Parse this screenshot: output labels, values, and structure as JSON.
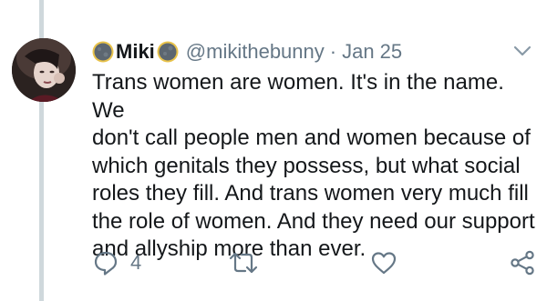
{
  "tweet": {
    "author": {
      "display_name": "Miki",
      "handle": "@mikithebunny",
      "name_emoji_left": "new-moon-emoji",
      "name_emoji_right": "new-moon-emoji"
    },
    "separator": "·",
    "date": "Jan 25",
    "text": "Trans women are women. It's in the name. We\ndon't call people men and women because of\nwhich genitals they possess, but what social\nroles they fill. And trans women very much fill\nthe role of women. And they need our support\nand allyship more than ever.",
    "actions": {
      "reply_icon": "reply-icon",
      "reply_count": "4",
      "retweet_icon": "retweet-icon",
      "like_icon": "heart-icon",
      "share_icon": "share-icon"
    }
  },
  "colors": {
    "text": "#14171a",
    "secondary": "#657786",
    "thread_line": "#cfd8dc"
  }
}
